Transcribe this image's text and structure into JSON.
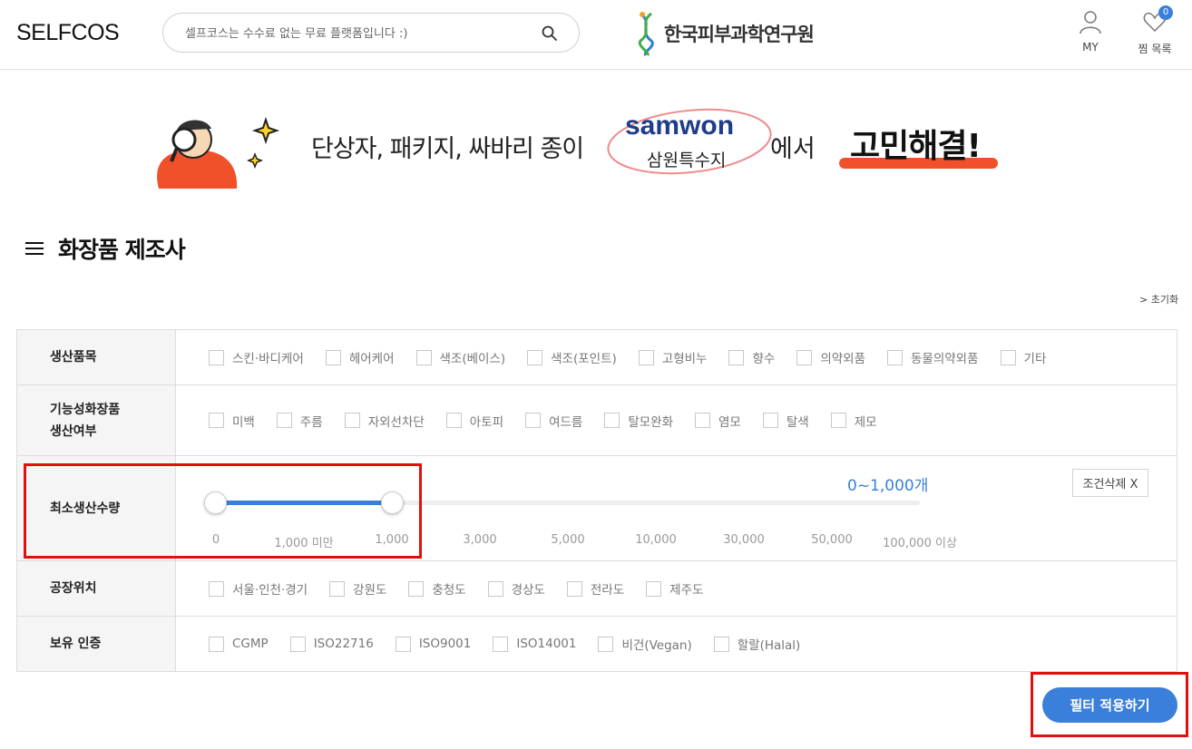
{
  "header": {
    "logo": "SELFCOS",
    "search_placeholder": "셀프코스는 수수료 없는 무료 플랫폼입니다 :)",
    "partner_name": "한국피부과학연구원",
    "my_label": "MY",
    "wishlist_label": "찜 목록",
    "wishlist_count": "0"
  },
  "banner": {
    "text1": "단상자, 패키지, 싸바리 종이",
    "brand_en": "samwon",
    "brand_ko": "삼원특수지",
    "text2": "에서",
    "text3": "고민해결!"
  },
  "page": {
    "title": "화장품 제조사",
    "reset_label": "> 초기화"
  },
  "filters": {
    "product": {
      "label": "생산품목",
      "options": [
        "스킨·바디케어",
        "헤어케어",
        "색조(베이스)",
        "색조(포인트)",
        "고형비누",
        "향수",
        "의약외품",
        "동물의약외품",
        "기타"
      ]
    },
    "functional": {
      "label_line1": "기능성화장품",
      "label_line2": "생산여부",
      "options": [
        "미백",
        "주름",
        "자외선차단",
        "아토피",
        "여드름",
        "탈모완화",
        "염모",
        "탈색",
        "제모"
      ]
    },
    "moq": {
      "label": "최소생산수량",
      "range_value": "0~1,000개",
      "clear_label": "조건삭제 X",
      "ticks": [
        "0",
        "1,000 미만",
        "1,000",
        "3,000",
        "5,000",
        "10,000",
        "30,000",
        "50,000",
        "100,000 이상"
      ],
      "selected_from_index": 0,
      "selected_to_index": 2
    },
    "location": {
      "label": "공장위치",
      "options": [
        "서울·인천·경기",
        "강원도",
        "충청도",
        "경상도",
        "전라도",
        "제주도"
      ]
    },
    "certification": {
      "label": "보유 인증",
      "options": [
        "CGMP",
        "ISO22716",
        "ISO9001",
        "ISO14001",
        "비건(Vegan)",
        "할랄(Halal)"
      ]
    }
  },
  "apply_label": "필터 적용하기",
  "colors": {
    "accent": "#3a7fd9",
    "highlight": "#e20f0f",
    "banner_orange": "#f0502a"
  }
}
